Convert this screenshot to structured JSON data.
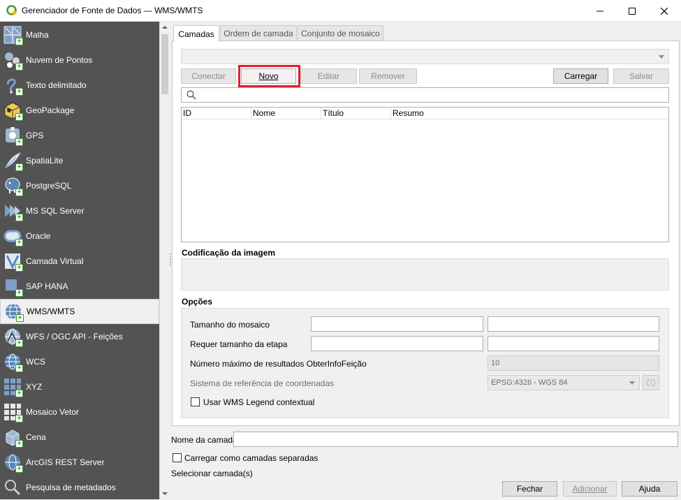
{
  "window": {
    "title": "Gerenciador de Fonte de Dados — WMS/WMTS",
    "app_icon": "qgis-icon",
    "min_icon": "minimize-icon",
    "max_icon": "maximize-icon",
    "close_icon": "close-icon"
  },
  "sidebar": {
    "items": [
      {
        "label": "Malha",
        "icon": "raster-icon"
      },
      {
        "label": "Nuvem de Pontos",
        "icon": "point-cloud-icon"
      },
      {
        "label": "Texto delimitado",
        "icon": "delimited-text-icon"
      },
      {
        "label": "GeoPackage",
        "icon": "geopackage-icon"
      },
      {
        "label": "GPS",
        "icon": "gps-icon"
      },
      {
        "label": "SpatiaLite",
        "icon": "spatialite-icon"
      },
      {
        "label": "PostgreSQL",
        "icon": "postgresql-icon"
      },
      {
        "label": "MS SQL Server",
        "icon": "mssql-icon"
      },
      {
        "label": "Oracle",
        "icon": "oracle-icon"
      },
      {
        "label": "Camada Virtual",
        "icon": "virtual-layer-icon"
      },
      {
        "label": "SAP HANA",
        "icon": "sap-hana-icon"
      },
      {
        "label": "WMS/WMTS",
        "icon": "wms-icon",
        "selected": true
      },
      {
        "label": "WFS / OGC API - Feições",
        "icon": "wfs-icon"
      },
      {
        "label": "WCS",
        "icon": "wcs-icon"
      },
      {
        "label": "XYZ",
        "icon": "xyz-icon"
      },
      {
        "label": "Mosaico Vetor",
        "icon": "vector-tile-icon"
      },
      {
        "label": "Cena",
        "icon": "scene-icon"
      },
      {
        "label": "ArcGIS REST Server",
        "icon": "arcgis-icon"
      },
      {
        "label": "Pesquisa de metadados",
        "icon": "metadata-search-icon"
      }
    ]
  },
  "tabs": [
    {
      "label": "Camadas",
      "active": true
    },
    {
      "label": "Ordem de camada",
      "active": false
    },
    {
      "label": "Conjunto de mosaico",
      "active": false
    }
  ],
  "connection_select": {
    "value": ""
  },
  "buttons": {
    "connect": "Conectar",
    "new": "Novo",
    "edit": "Editar",
    "remove": "Remover",
    "load": "Carregar",
    "save": "Salvar"
  },
  "search": {
    "placeholder": "",
    "icon": "search-icon"
  },
  "layers_table": {
    "columns": [
      "ID",
      "Nome",
      "Título",
      "Resumo"
    ],
    "rows": []
  },
  "image_encoding": {
    "label": "Codificação da imagem"
  },
  "options": {
    "label": "Opções",
    "tile_size_label": "Tamanho do mosaico",
    "tile_width": "",
    "tile_height": "",
    "step_size_label": "Requer tamanho da etapa",
    "step_width": "",
    "step_height": "",
    "max_results_label": "Número máximo de resultados ObterInfoFeição",
    "max_results_value": "10",
    "crs_label": "Sistema de referência de coordenadas",
    "crs_value": "EPSG:4326 - WGS 84",
    "crs_button_icon": "crs-selector-icon",
    "contextual_legend_label": "Usar WMS Legend contextual",
    "contextual_legend_checked": false
  },
  "layer_name": {
    "label": "Nome da camada",
    "value": ""
  },
  "load_separate": {
    "label": "Carregar como camadas separadas",
    "checked": false
  },
  "status": "Selecionar camada(s)",
  "footer": {
    "close": "Fechar",
    "add": "Adicionar",
    "help": "Ajuda"
  },
  "colors": {
    "sidebar_bg": "#535353",
    "highlight": "#e0202b",
    "qgis_green": "#589632"
  }
}
